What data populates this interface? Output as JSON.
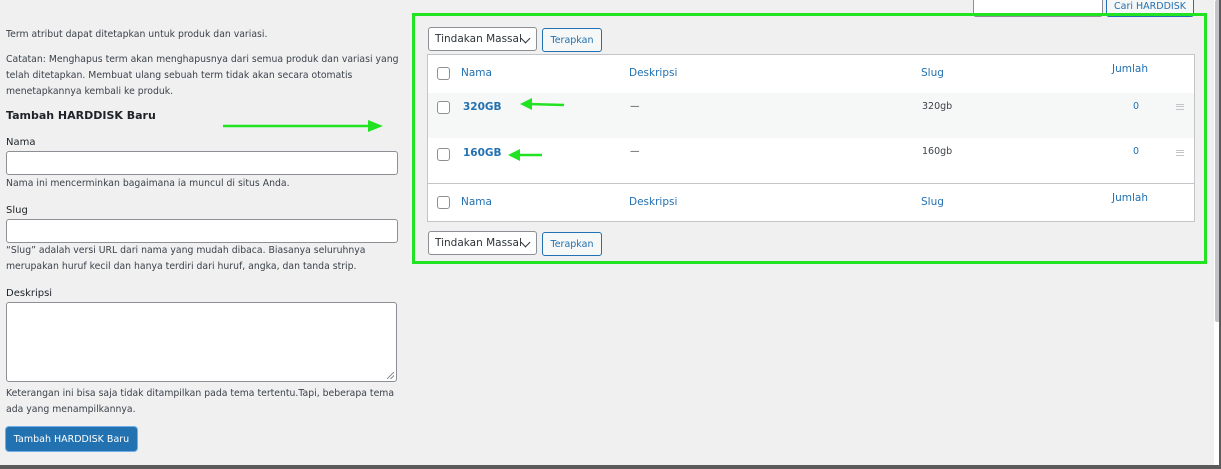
{
  "left_panel": {
    "intro": "Term atribut dapat ditetapkan untuk produk dan variasi.",
    "note": "Catatan: Menghapus term akan menghapusnya dari semua produk dan variasi yang telah ditetapkan. Membuat ulang sebuah term tidak akan secara otomatis menetapkannya kembali ke produk.",
    "heading": "Tambah HARDDISK Baru",
    "name_label": "Nama",
    "name_value": "",
    "name_help": "Nama ini mencerminkan bagaimana ia muncul di situs Anda.",
    "slug_label": "Slug",
    "slug_value": "",
    "slug_help": "“Slug” adalah versi URL dari nama yang mudah dibaca. Biasanya seluruhnya merupakan huruf kecil dan hanya terdiri dari huruf, angka, dan tanda strip.",
    "desc_label": "Deskripsi",
    "desc_value": "",
    "desc_help": "Keterangan ini bisa saja tidak ditampilkan pada tema tertentu.Tapi, beberapa tema ada yang menampilkannya.",
    "submit_label": "Tambah HARDDISK Baru"
  },
  "search": {
    "value": "",
    "button_label": "Cari HARDDISK"
  },
  "bulk": {
    "selected": "Tindakan Massal",
    "apply_label": "Terapkan"
  },
  "table": {
    "headers": {
      "name": "Nama",
      "description": "Deskripsi",
      "slug": "Slug",
      "count": "Jumlah"
    },
    "rows": [
      {
        "name": "320GB",
        "description": "—",
        "slug": "320gb",
        "count": "0"
      },
      {
        "name": "160GB",
        "description": "—",
        "slug": "160gb",
        "count": "0"
      }
    ]
  },
  "colors": {
    "accent": "#2271b1",
    "highlight": "#22e322",
    "background": "#f0f0f1"
  }
}
